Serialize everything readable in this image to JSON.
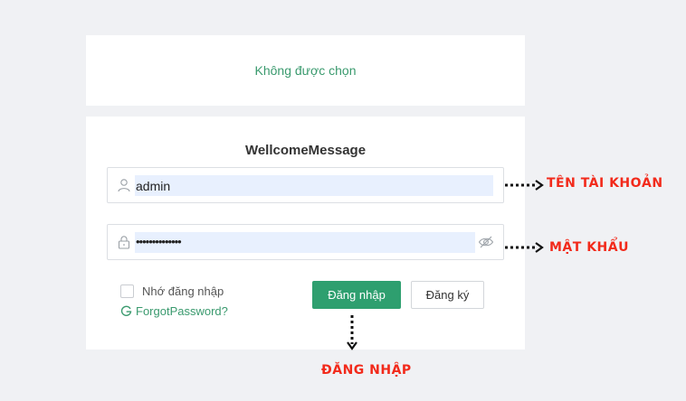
{
  "top_card": {
    "selection_text": "Không được chọn"
  },
  "login_form": {
    "welcome_message": "WellcomeMessage",
    "username_value": "admin",
    "password_value": "••••••••••••••",
    "remember_label": "Nhớ đăng nhập",
    "forgot_label": "ForgotPassword?",
    "login_button": "Đăng nhập",
    "register_button": "Đăng ký"
  },
  "annotations": {
    "username": "TÊN TÀI KHOẢN",
    "password": "MẬT KHẨU",
    "login": "ĐĂNG NHẬP"
  },
  "colors": {
    "accent": "#2e9f6f",
    "annotation": "#f22a1b",
    "autofill": "#e8f0fe"
  }
}
